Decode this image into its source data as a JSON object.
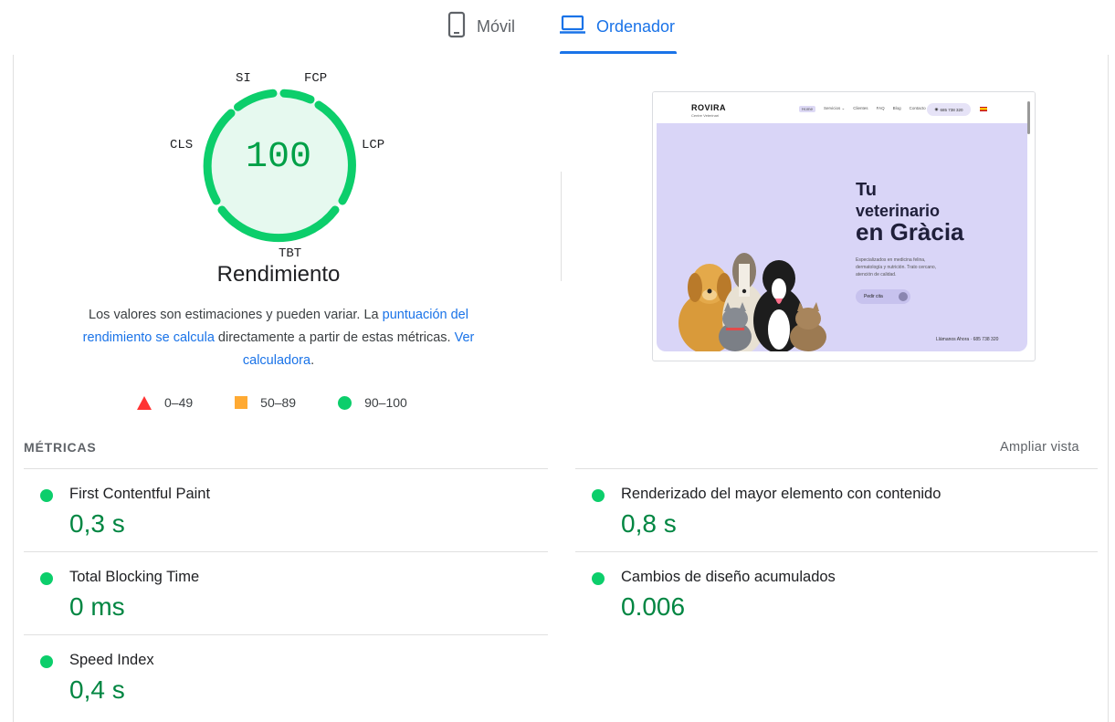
{
  "tabs": [
    {
      "label": "Móvil",
      "active": false
    },
    {
      "label": "Ordenador",
      "active": true
    }
  ],
  "gauge": {
    "score": "100",
    "score_fraction": 1.0,
    "title": "Rendimiento",
    "labels": {
      "si": "SI",
      "fcp": "FCP",
      "lcp": "LCP",
      "tbt": "TBT",
      "cls": "CLS"
    }
  },
  "description": {
    "part1": "Los valores son estimaciones y pueden variar. La ",
    "link1": "puntuación del rendimiento se calcula",
    "part2": " directamente a partir de estas métricas. ",
    "link2": "Ver calculadora",
    "part3": "."
  },
  "legend": [
    {
      "shape": "triangle",
      "label": "0–49",
      "color": "#ff3333"
    },
    {
      "shape": "square",
      "label": "50–89",
      "color": "#ffaa33"
    },
    {
      "shape": "circle",
      "label": "90–100",
      "color": "#0cce6b"
    }
  ],
  "preview": {
    "logo": "ROVIRA",
    "logo_sub": "Centre Veterinari",
    "menu": [
      "Home",
      "Servicios ⌄",
      "Clientes",
      "FAQ",
      "Blog",
      "Contacto"
    ],
    "phone": "685 738 320",
    "hero_line1": "Tu",
    "hero_line2": "veterinario",
    "hero_line3": "en Gràcia",
    "hero_sub": "Especializados en medicina felina, dermatología y nutrición. Trato cercano, atención de calidad.",
    "cta": "Pedir cita",
    "call": "Llámanos Ahora · 685 738 320"
  },
  "metrics": {
    "heading": "MÉTRICAS",
    "expand": "Ampliar vista",
    "items": [
      {
        "name": "First Contentful Paint",
        "value": "0,3 s",
        "status": "good"
      },
      {
        "name": "Renderizado del mayor elemento con contenido",
        "value": "0,8 s",
        "status": "good"
      },
      {
        "name": "Total Blocking Time",
        "value": "0 ms",
        "status": "good"
      },
      {
        "name": "Cambios de diseño acumulados",
        "value": "0.006",
        "status": "good"
      },
      {
        "name": "Speed Index",
        "value": "0,4 s",
        "status": "good"
      }
    ]
  },
  "colors": {
    "accent": "#1a73e8",
    "good": "#0cce6b",
    "good_text": "#018642"
  }
}
